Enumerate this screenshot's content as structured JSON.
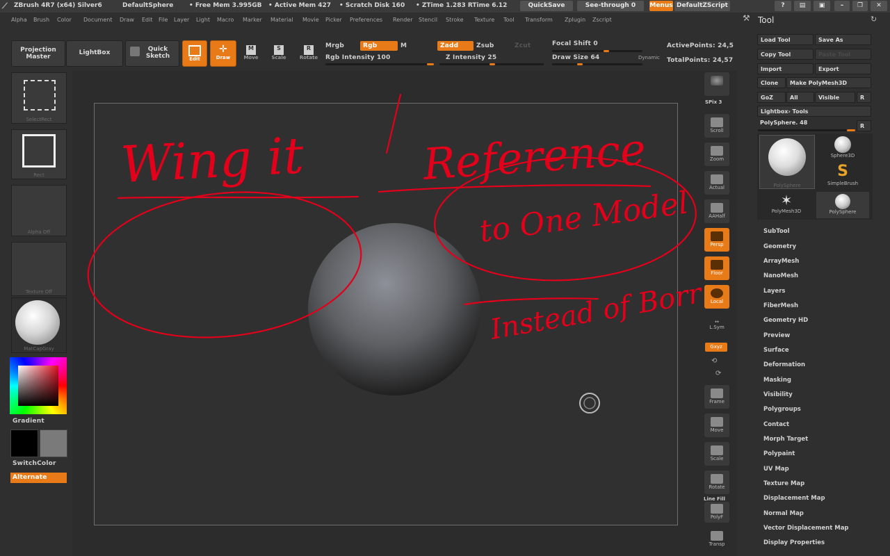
{
  "titlebar": {
    "app": "ZBrush 4R7 (x64) Silver6",
    "document": "DefaultSphere",
    "free_mem": "• Free Mem 3.995GB",
    "active_mem": "• Active Mem 427",
    "scratch": "• Scratch Disk 160",
    "timing": "• ZTime 1.283  RTime 6.12",
    "quicksave": "QuickSave",
    "see_through": "See-through  0",
    "menus": "Menus",
    "default_script": "DefaultZScript"
  },
  "menubar": {
    "items": [
      "Alpha",
      "Brush",
      "Color",
      "Document",
      "Draw",
      "Edit",
      "File",
      "Layer",
      "Light",
      "Macro",
      "Marker",
      "Material",
      "Movie",
      "Picker",
      "Preferences",
      "Render",
      "Stencil",
      "Stroke",
      "Texture",
      "Tool",
      "Transform",
      "Zplugin",
      "Zscript"
    ]
  },
  "shelf": {
    "projection_master": "Projection Master",
    "lightbox": "LightBox",
    "quick_sketch": "Quick Sketch",
    "edit": "Edit",
    "draw": "Draw",
    "move": "Move",
    "scale": "Scale",
    "rotate": "Rotate",
    "mrgb": "Mrgb",
    "rgb": "Rgb",
    "m": "M",
    "rgb_intensity": "Rgb Intensity 100",
    "zadd": "Zadd",
    "zsub": "Zsub",
    "zcut": "Zcut",
    "z_intensity": "Z Intensity 25",
    "focal_shift": "Focal Shift 0",
    "draw_size": "Draw Size 64",
    "dynamic": "Dynamic",
    "active_points": "ActivePoints: 24,5",
    "total_points": "TotalPoints: 24,57"
  },
  "leftshelf": {
    "select_rect": "SelectRect",
    "rect": "Rect",
    "alpha_off": "Alpha Off",
    "texture_off": "Texture Off",
    "matcap": "MatCapGray",
    "gradient": "Gradient",
    "switch_color": "SwitchColor",
    "alternate": "Alternate"
  },
  "rightshelf": {
    "spix": "SPix 3",
    "scroll": "Scroll",
    "zoom": "Zoom",
    "actual": "Actual",
    "aahalf": "AAHalf",
    "persp": "Persp",
    "floor": "Floor",
    "local": "Local",
    "lsym": "L.Sym",
    "xyz": "Gxyz",
    "frame": "Frame",
    "move": "Move",
    "scale": "Scale",
    "rotate": "Rotate",
    "line_fill": "Line Fill",
    "polyf": "PolyF",
    "transp": "Transp"
  },
  "annotations": {
    "text1": "Wing it",
    "text2": "Reference",
    "text3": "to One Model",
    "text4": "Instead of Borrowing"
  },
  "toolpanel": {
    "title": "Tool",
    "load_tool": "Load Tool",
    "save_as": "Save As",
    "copy_tool": "Copy Tool",
    "paste_tool": "Paste Tool",
    "import": "Import",
    "export": "Export",
    "clone": "Clone",
    "make_polymesh": "Make PolyMesh3D",
    "goz": "GoZ",
    "all": "All",
    "visible": "Visible",
    "r": "R",
    "lightbox_tools": "Lightbox› Tools",
    "polysphere_slider": "PolySphere. 48",
    "thumbs": [
      "PolySphere",
      "Sphere3D",
      "SimpleBrush",
      "PolyMesh3D",
      "PolySphere"
    ],
    "sections": [
      "SubTool",
      "Geometry",
      "ArrayMesh",
      "NanoMesh",
      "Layers",
      "FiberMesh",
      "Geometry HD",
      "Preview",
      "Surface",
      "Deformation",
      "Masking",
      "Visibility",
      "Polygroups",
      "Contact",
      "Morph Target",
      "Polypaint",
      "UV Map",
      "Texture Map",
      "Displacement Map",
      "Normal Map",
      "Vector Displacement Map",
      "Display Properties"
    ]
  }
}
